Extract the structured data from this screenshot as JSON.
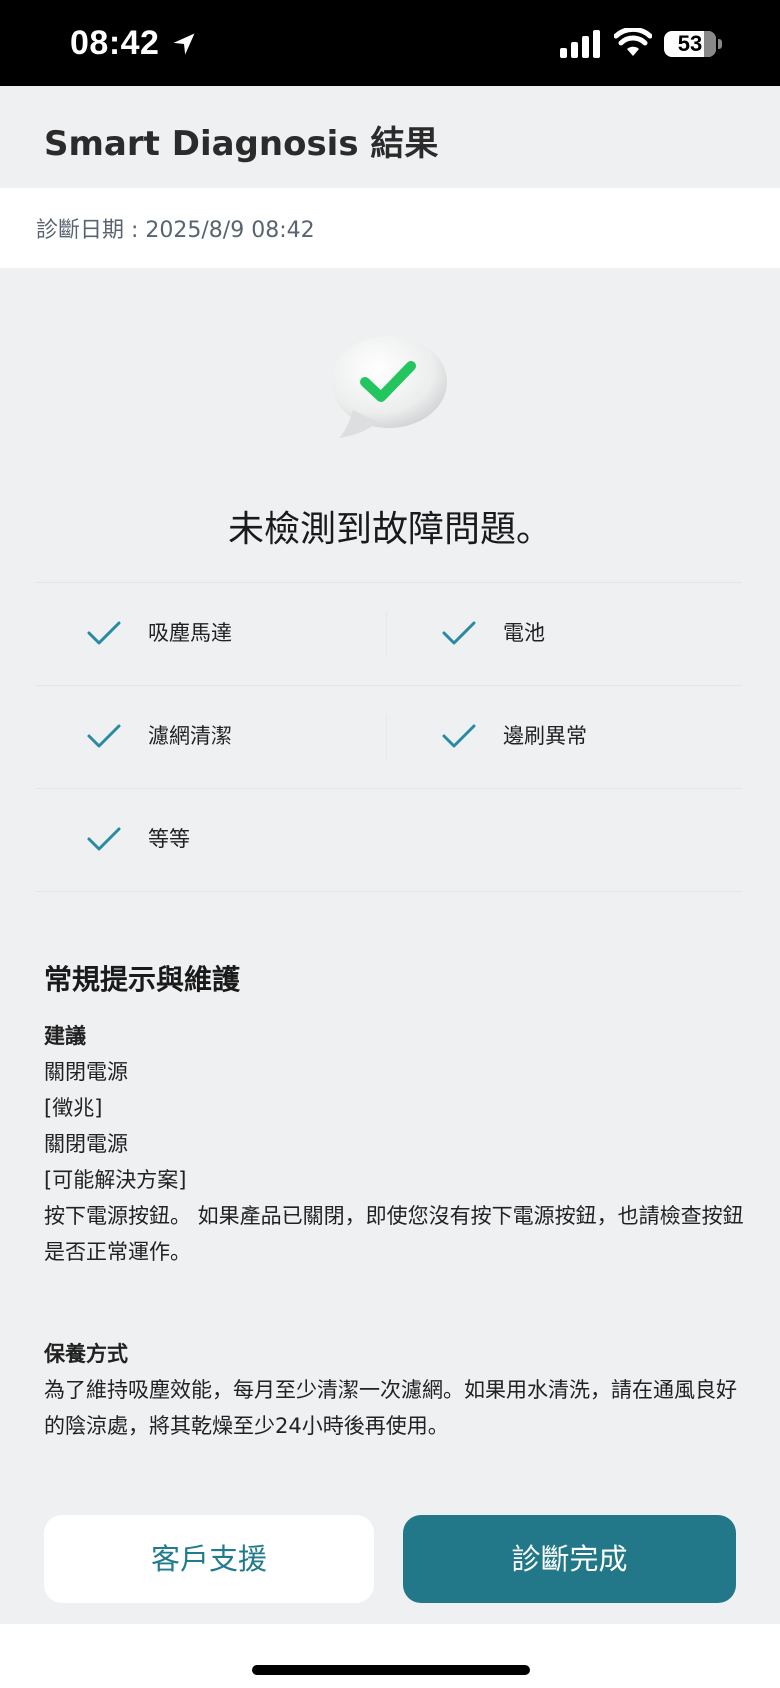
{
  "status_bar": {
    "time": "08:42",
    "battery": "53",
    "icons": [
      "location-arrow-icon",
      "cellular-signal-icon",
      "wifi-icon",
      "battery-icon"
    ]
  },
  "header": {
    "title": "Smart Diagnosis 結果"
  },
  "diagnosis": {
    "date_label": "診斷日期 : 2025/8/9 08:42",
    "result_icon": "check-bubble-icon",
    "result_title": "未檢測到故障問題。",
    "check_color": "#2a8aa3",
    "items": [
      "吸塵馬達",
      "電池",
      "濾網清潔",
      "邊刷異常",
      "等等"
    ]
  },
  "tips": {
    "heading": "常規提示與維護",
    "advice_title": "建議",
    "advice_lines": [
      "關閉電源",
      "[徵兆]",
      "關閉電源",
      "[可能解決方案]",
      "按下電源按鈕。 如果產品已關閉，即使您沒有按下電源按鈕，也請檢查按鈕是否正常運作。"
    ],
    "maintenance_title": "保養方式",
    "maintenance_text": "為了維持吸塵效能，每月至少清潔一次濾網。如果用水清洗，請在通風良好的陰涼處，將其乾燥至少24小時後再使用。"
  },
  "buttons": {
    "support": "客戶支援",
    "done": "診斷完成"
  },
  "colors": {
    "accent": "#227889",
    "accent_text": "#217a8e",
    "check_green": "#22c55e",
    "background": "#eff0f2"
  }
}
